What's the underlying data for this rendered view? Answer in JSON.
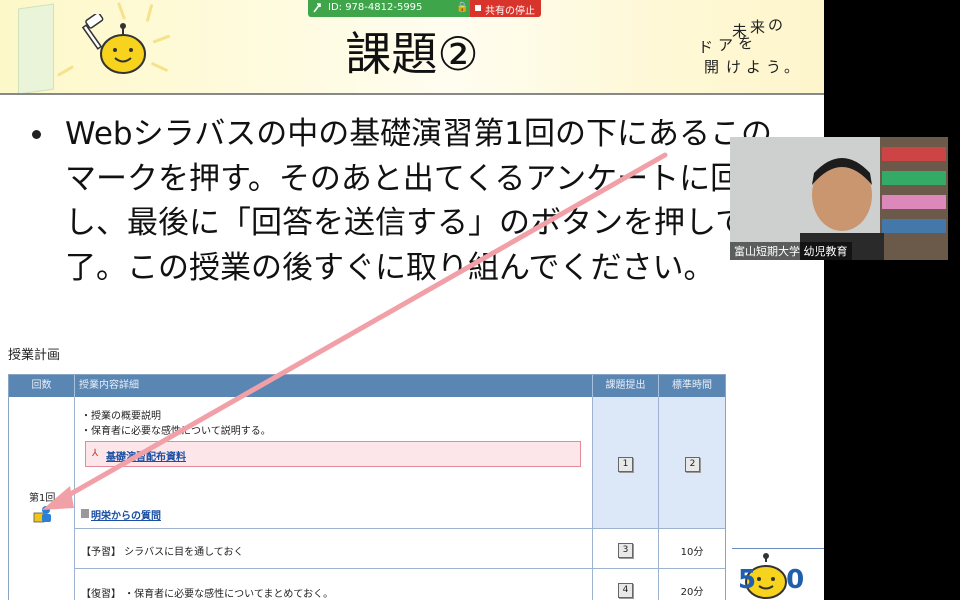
{
  "share_bar": {
    "id_text": "ID: 978-4812-5995",
    "stop_label": "共有の停止",
    "share_icon": "screen-share-icon",
    "lock_icon": "lock-icon"
  },
  "slide": {
    "title": "課題②",
    "tagline": [
      "未",
      "来",
      "の",
      "ド",
      "ア",
      "を",
      "開",
      "け",
      "よ",
      "う",
      "。"
    ],
    "bullet": "Webシラバスの中の基礎演習第1回の下にあるこのマークを押す。そのあと出てくるアンケートに回答し、最後に「回答を送信する」のボタンを押して終了。この授業の後すぐに取り組んでください。",
    "plan_label": "授業計画",
    "table": {
      "headers": [
        "回数",
        "授業内容詳細",
        "課題提出",
        "標準時間"
      ],
      "row1": {
        "session": "第1回",
        "details": [
          "・授業の概要説明",
          "・保育者に必要な感性について説明する。"
        ],
        "material_link": "基礎演習配布資料",
        "question_link": "明栄からの質問",
        "submit_icon": "1",
        "time_icon": "2"
      },
      "prep": {
        "text": "【予習】 シラバスに目を通しておく",
        "icon": "3",
        "time": "10分"
      },
      "review": {
        "text": "【復習】 ・保育者に必要な感性についてまとめておく。",
        "icon": "4",
        "time": "20分"
      }
    },
    "bottom_logo_text": "50"
  },
  "webcam": {
    "label": "富山短期大学 幼児教育"
  },
  "colors": {
    "header_bg": "#fdf8c8",
    "table_header": "#5a86b4",
    "table_blue": "#dce8f7",
    "link_box_bg": "#fde6ea",
    "link_box_border": "#e48a9a",
    "arrow": "#f2a0a8",
    "share_green": "#3fa54a",
    "stop_red": "#d9342b"
  }
}
